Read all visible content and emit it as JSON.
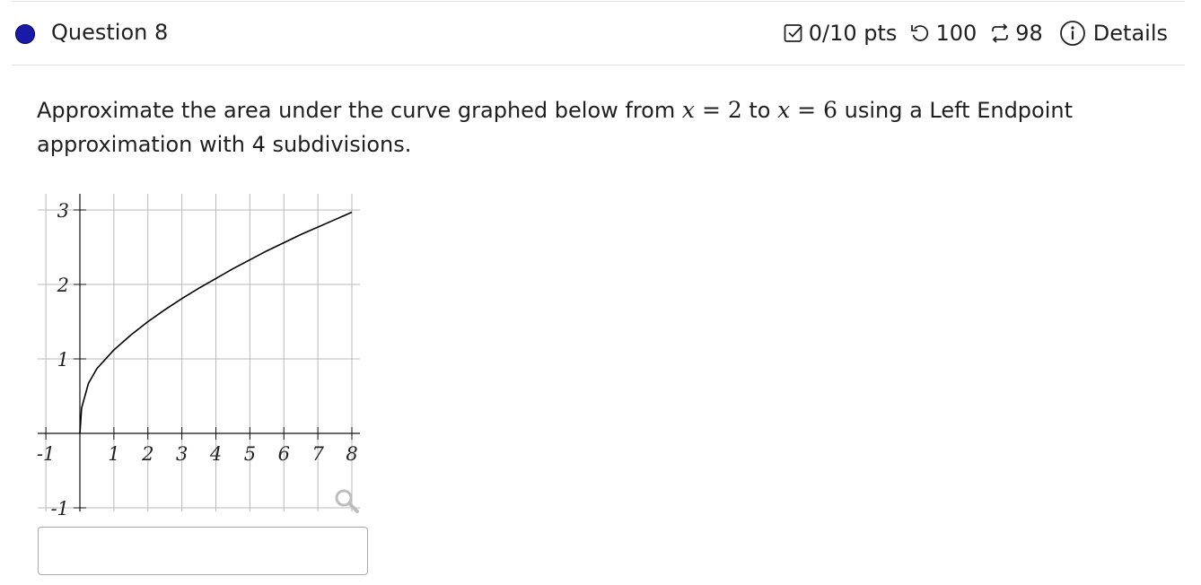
{
  "header": {
    "question_title": "Question 8",
    "score": "0/10 pts",
    "attempts": "100",
    "submissions": "98",
    "details_label": "Details",
    "status_color": "#1a1aa8"
  },
  "prompt": {
    "text_1": "Approximate the area under the curve graphed below from ",
    "var_1": "x",
    "eq_1": "=",
    "val_1": "2",
    "text_2": " to ",
    "var_2": "x",
    "eq_2": "=",
    "val_2": "6",
    "text_3": " using a Left Endpoint approximation with 4 subdivisions."
  },
  "chart_data": {
    "type": "line",
    "title": "",
    "xlabel": "",
    "ylabel": "",
    "xlim": [
      -1,
      8
    ],
    "ylim": [
      -1,
      3
    ],
    "grid": true,
    "x_ticks": [
      "-1",
      "1",
      "2",
      "3",
      "4",
      "5",
      "6",
      "7",
      "8"
    ],
    "y_ticks": [
      "3",
      "2",
      "1",
      "-1"
    ],
    "x_tick_values": [
      -1,
      1,
      2,
      3,
      4,
      5,
      6,
      7,
      8
    ],
    "y_tick_values": [
      3,
      2,
      1,
      -1
    ],
    "series": [
      {
        "x": [
          0,
          0.05,
          0.25,
          0.5,
          1,
          1.5,
          2,
          2.5,
          3,
          3.5,
          4,
          4.5,
          5,
          5.5,
          6,
          6.5,
          7,
          7.5,
          8
        ],
        "y": [
          0,
          0.34,
          0.67,
          0.87,
          1.12,
          1.32,
          1.5,
          1.66,
          1.81,
          1.95,
          2.08,
          2.21,
          2.33,
          2.45,
          2.56,
          2.67,
          2.77,
          2.87,
          2.97
        ]
      }
    ],
    "icons": [
      "magnifier-icon"
    ]
  },
  "answer": {
    "value": ""
  }
}
